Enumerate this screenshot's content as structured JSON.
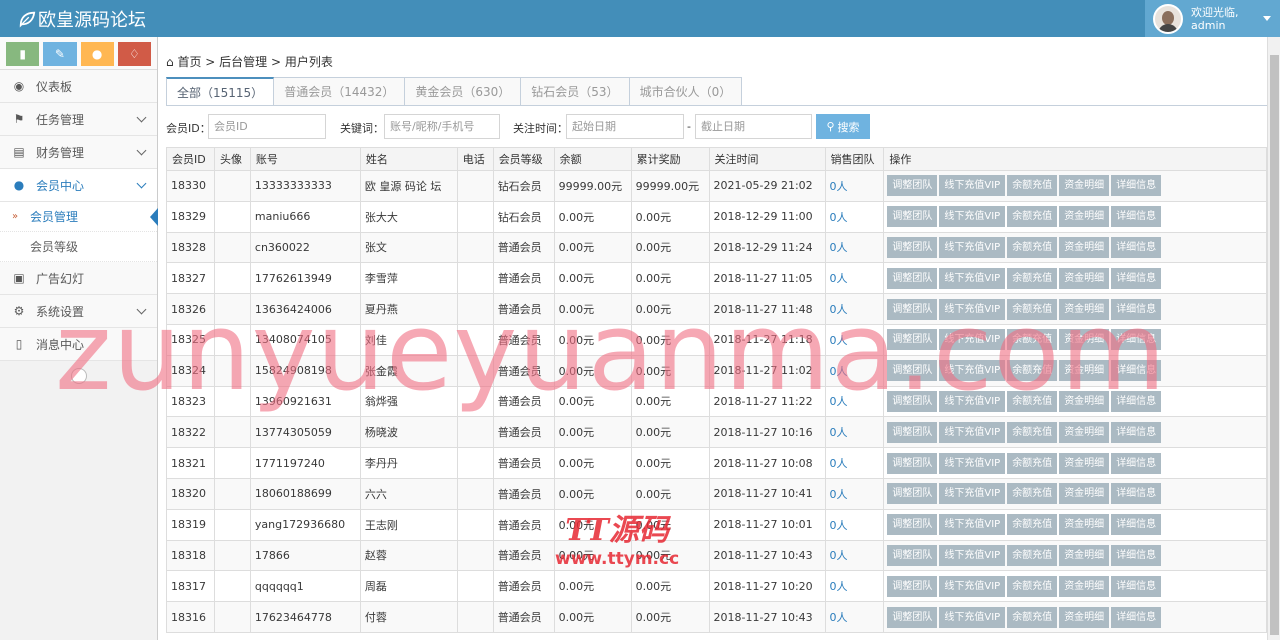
{
  "brand": {
    "title": "欧皇源码论坛"
  },
  "user": {
    "welcome": "欢迎光临,",
    "name": "admin"
  },
  "sidebar": {
    "shortcuts": [
      "signal-icon",
      "pencil-icon",
      "users-icon",
      "bell-icon"
    ],
    "items": [
      {
        "label": "仪表板",
        "icon": "dashboard-icon"
      },
      {
        "label": "任务管理",
        "icon": "flag-icon"
      },
      {
        "label": "财务管理",
        "icon": "print-icon"
      },
      {
        "label": "会员中心",
        "icon": "user-icon"
      },
      {
        "label": "广告幻灯",
        "icon": "picture-icon"
      },
      {
        "label": "系统设置",
        "icon": "cog-icon"
      },
      {
        "label": "消息中心",
        "icon": "bookmark-icon"
      }
    ],
    "subitems": [
      "会员管理",
      "会员等级"
    ]
  },
  "breadcrumb": {
    "home": "首页",
    "sep1": " > ",
    "section": "后台管理",
    "sep2": " > ",
    "page": "用户列表"
  },
  "tabs": [
    "全部（15115）",
    "普通会员（14432）",
    "黄金会员（630）",
    "钻石会员（53）",
    "城市合伙人（0）"
  ],
  "filters": {
    "member_id_label": "会员ID：",
    "member_id_placeholder": "会员ID",
    "keyword_label": "关键词：",
    "keyword_placeholder": "账号/昵称/手机号",
    "date_label": "关注时间：",
    "start_placeholder": "起始日期",
    "dash": "-",
    "end_placeholder": "截止日期",
    "search_label": "搜索"
  },
  "table": {
    "headers": [
      "会员ID",
      "头像",
      "账号",
      "姓名",
      "电话",
      "会员等级",
      "余额",
      "累计奖励",
      "关注时间",
      "销售团队",
      "操作"
    ],
    "actions": [
      "调整团队",
      "线下充值VIP",
      "余额充值",
      "资金明细",
      "详细信息"
    ],
    "rows": [
      [
        "18330",
        "",
        "13333333333",
        "欧 皇源 码论 坛",
        "",
        "钻石会员",
        "99999.00元",
        "99999.00元",
        "2021-05-29 21:02",
        "0人"
      ],
      [
        "18329",
        "",
        "maniu666",
        "张大大",
        "",
        "钻石会员",
        "0.00元",
        "0.00元",
        "2018-12-29 11:00",
        "0人"
      ],
      [
        "18328",
        "",
        "cn360022",
        "张文",
        "",
        "普通会员",
        "0.00元",
        "0.00元",
        "2018-12-29 11:24",
        "0人"
      ],
      [
        "18327",
        "",
        "17762613949",
        "李雪萍",
        "",
        "普通会员",
        "0.00元",
        "0.00元",
        "2018-11-27 11:05",
        "0人"
      ],
      [
        "18326",
        "",
        "13636424006",
        "夏丹燕",
        "",
        "普通会员",
        "0.00元",
        "0.00元",
        "2018-11-27 11:48",
        "0人"
      ],
      [
        "18325",
        "",
        "13408074105",
        "刘佳",
        "",
        "普通会员",
        "0.00元",
        "0.00元",
        "2018-11-27 11:18",
        "0人"
      ],
      [
        "18324",
        "",
        "15824908198",
        "张金霞",
        "",
        "普通会员",
        "0.00元",
        "0.00元",
        "2018-11-27 11:02",
        "0人"
      ],
      [
        "18323",
        "",
        "13960921631",
        "翁烨强",
        "",
        "普通会员",
        "0.00元",
        "0.00元",
        "2018-11-27 11:22",
        "0人"
      ],
      [
        "18322",
        "",
        "13774305059",
        "杨晓波",
        "",
        "普通会员",
        "0.00元",
        "0.00元",
        "2018-11-27 10:16",
        "0人"
      ],
      [
        "18321",
        "",
        "1771197240",
        "李丹丹",
        "",
        "普通会员",
        "0.00元",
        "0.00元",
        "2018-11-27 10:08",
        "0人"
      ],
      [
        "18320",
        "",
        "18060188699",
        "六六",
        "",
        "普通会员",
        "0.00元",
        "0.00元",
        "2018-11-27 10:41",
        "0人"
      ],
      [
        "18319",
        "",
        "yang172936680",
        "王志刚",
        "",
        "普通会员",
        "0.00元",
        "0.00元",
        "2018-11-27 10:01",
        "0人"
      ],
      [
        "18318",
        "",
        "17866",
        "赵蓉",
        "",
        "普通会员",
        "0.00元",
        "0.00元",
        "2018-11-27 10:43",
        "0人"
      ],
      [
        "18317",
        "",
        "qqqqqq1",
        "周磊",
        "",
        "普通会员",
        "0.00元",
        "0.00元",
        "2018-11-27 10:20",
        "0人"
      ],
      [
        "18316",
        "",
        "17623464778",
        "付蓉",
        "",
        "普通会员",
        "0.00元",
        "0.00元",
        "2018-11-27 10:43",
        "0人"
      ]
    ]
  },
  "watermarks": {
    "main": "zunyueyuanma.com",
    "logo_text": "TT源码",
    "logo_url": "www.ttym.cc"
  }
}
